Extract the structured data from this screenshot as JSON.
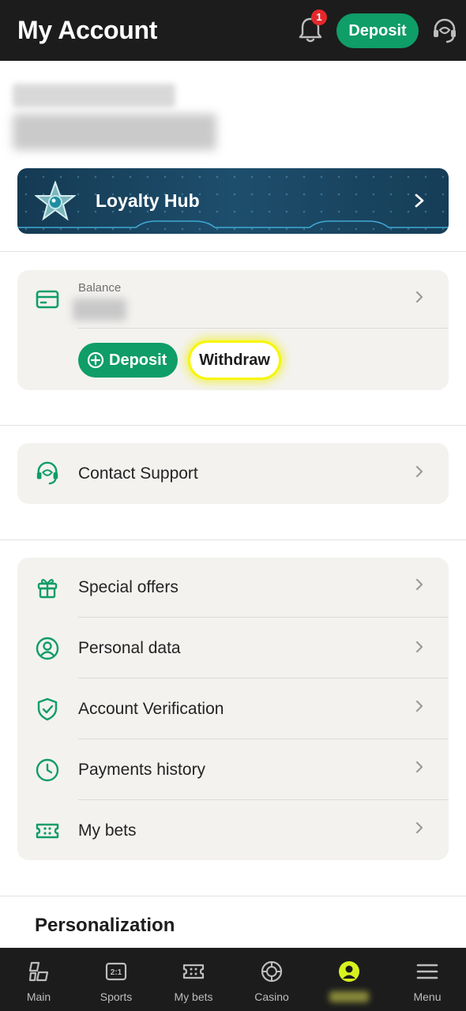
{
  "header": {
    "title": "My Account",
    "notification_count": "1",
    "deposit_label": "Deposit"
  },
  "profile": {
    "line1": "",
    "line2": ""
  },
  "loyalty": {
    "title": "Loyalty Hub"
  },
  "balance": {
    "label": "Balance",
    "value": "",
    "deposit_label": "Deposit",
    "withdraw_label": "Withdraw"
  },
  "support": {
    "label": "Contact Support"
  },
  "menu": {
    "items": [
      {
        "label": "Special offers",
        "icon": "gift-icon"
      },
      {
        "label": "Personal data",
        "icon": "user-circle-icon"
      },
      {
        "label": "Account Verification",
        "icon": "shield-check-icon"
      },
      {
        "label": "Payments history",
        "icon": "clock-icon"
      },
      {
        "label": "My bets",
        "icon": "ticket-icon"
      }
    ]
  },
  "personalization": {
    "title": "Personalization"
  },
  "bottom_nav": {
    "items": [
      {
        "label": "Main",
        "icon": "main-icon"
      },
      {
        "label": "Sports",
        "icon": "sports-icon"
      },
      {
        "label": "My bets",
        "icon": "ticket-icon"
      },
      {
        "label": "Casino",
        "icon": "casino-chip-icon"
      },
      {
        "label": "",
        "icon": "user-icon",
        "active": true
      },
      {
        "label": "Menu",
        "icon": "hamburger-icon"
      }
    ]
  },
  "colors": {
    "brand_green": "#0f9d68",
    "header_bg": "#1c1c1c",
    "card_bg": "#f3f2ef",
    "highlight": "#f6f600",
    "active_nav": "#d7f21f"
  }
}
